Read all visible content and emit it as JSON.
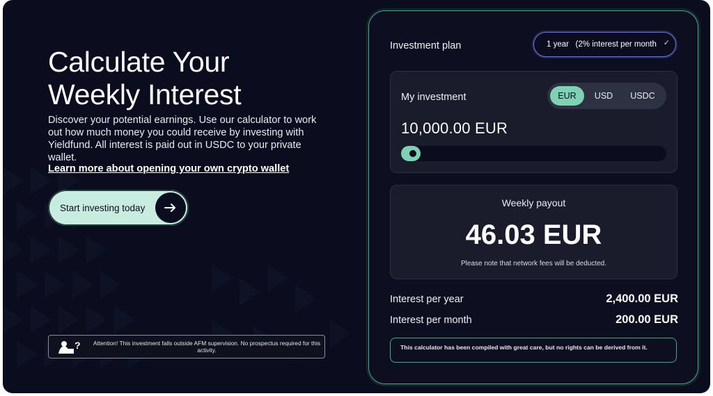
{
  "hero": {
    "title_line1": "Calculate Your",
    "title_line2": "Weekly Interest",
    "description": "Discover your potential earnings. Use our calculator to work out how much money you could receive by investing with Yieldfund. All interest is paid out in USDC to your private wallet.",
    "link_text": "Learn more about opening your own crypto wallet",
    "cta_label": "Start investing today",
    "cta_icon": "arrow-right-icon"
  },
  "warning": {
    "icon": "warning-person-question-icon",
    "text": "Attention! This investment falls outside AFM supervision. No prospectus required for this activity."
  },
  "calculator": {
    "plan_label": "Investment plan",
    "plan_value": "1 year   (2% interest per month",
    "plan_chevron": "✓",
    "investment_label": "My investment",
    "currencies": [
      "EUR",
      "USD",
      "USDC"
    ],
    "selected_currency": "EUR",
    "investment_amount": "10,000.00 EUR",
    "slider_fraction": 0.07,
    "payout_title": "Weekly payout",
    "payout_value": "46.03 EUR",
    "payout_note": "Please note that network fees will be deducted.",
    "interest_year_label": "Interest per year",
    "interest_year_value": "2,400.00 EUR",
    "interest_month_label": "Interest per month",
    "interest_month_value": "200.00 EUR",
    "disclaimer": "This calculator has been compiled with great care, but no rights can be derived from it."
  },
  "colors": {
    "background": "#0b0c1d",
    "accent": "#7fd1b3",
    "cta": "#c9ece0",
    "card": "#1a1c2c",
    "border_green": "#49a784",
    "select_border": "#6b77d8"
  }
}
